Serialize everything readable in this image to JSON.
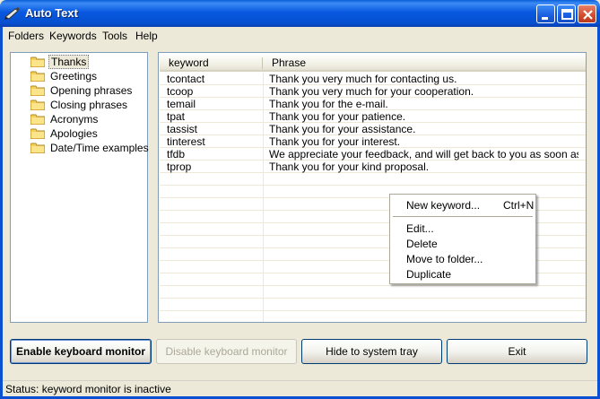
{
  "window": {
    "title": "Auto Text",
    "icon": "pen-icon"
  },
  "menu": [
    "Folders",
    "Keywords",
    "Tools",
    "Help"
  ],
  "folders": [
    "Thanks",
    "Greetings",
    "Opening phrases",
    "Closing phrases",
    "Acronyms",
    "Apologies",
    "Date/Time examples"
  ],
  "selected_folder": "Thanks",
  "table": {
    "headers": [
      "keyword",
      "Phrase"
    ],
    "rows": [
      [
        "tcontact",
        "Thank you very much for contacting us."
      ],
      [
        "tcoop",
        "Thank you very much for your cooperation."
      ],
      [
        "temail",
        "Thank you for the e-mail."
      ],
      [
        "tpat",
        "Thank you for your patience."
      ],
      [
        "tassist",
        "Thank you for your assistance."
      ],
      [
        "tinterest",
        "Thank you for your interest."
      ],
      [
        "tfdb",
        "We appreciate your feedback, and will get back to you as soon as pos..."
      ],
      [
        "tprop",
        "Thank you for your kind proposal."
      ]
    ]
  },
  "context_menu": {
    "new_keyword": "New keyword...",
    "new_keyword_shortcut": "Ctrl+N",
    "items": [
      "Edit...",
      "Delete",
      "Move to folder...",
      "Duplicate"
    ]
  },
  "buttons": {
    "enable": "Enable keyboard monitor",
    "disable": "Disable keyboard monitor",
    "hide": "Hide to system tray",
    "exit": "Exit"
  },
  "status": "Status: keyword monitor is inactive",
  "colors": {
    "titlebar": "#0858e0",
    "close_button": "#d24a2c",
    "background": "#ece9d8"
  }
}
